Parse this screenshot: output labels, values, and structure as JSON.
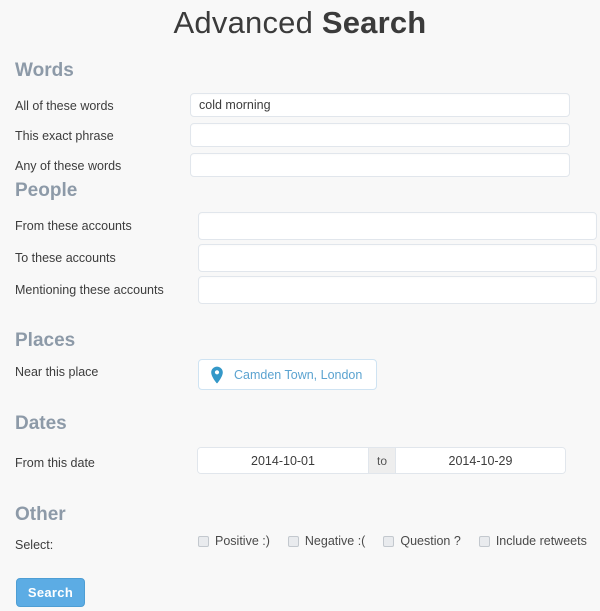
{
  "page": {
    "title_regular": "Advanced ",
    "title_strong": "Search"
  },
  "sections": {
    "words": {
      "heading": "Words",
      "fields": [
        {
          "label": "All of these words",
          "value": "cold morning",
          "placeholder": ""
        },
        {
          "label": "This exact phrase",
          "value": "",
          "placeholder": ""
        },
        {
          "label": "Any of these words",
          "value": "",
          "placeholder": ""
        }
      ]
    },
    "people": {
      "heading": "People",
      "fields": [
        {
          "label": "From these accounts",
          "value": "",
          "placeholder": ""
        },
        {
          "label": "To these accounts",
          "value": "",
          "placeholder": ""
        },
        {
          "label": "Mentioning these accounts",
          "value": "",
          "placeholder": ""
        }
      ]
    },
    "places": {
      "heading": "Places",
      "label": "Near this place",
      "icon": "map-pin-icon",
      "value": "Camden Town, London",
      "accent_color": "#5ba3d0"
    },
    "dates": {
      "heading": "Dates",
      "label": "From this date",
      "from_value": "2014-10-01",
      "separator": "to",
      "to_value": "2014-10-29"
    },
    "other": {
      "heading": "Other",
      "label": "Select:",
      "checkboxes": [
        {
          "label": "Positive :)",
          "checked": false
        },
        {
          "label": "Negative :(",
          "checked": false
        },
        {
          "label": "Question ?",
          "checked": false
        },
        {
          "label": "Include retweets",
          "checked": false
        }
      ]
    }
  },
  "submit": {
    "label": "Search",
    "color": "#5cace4"
  }
}
